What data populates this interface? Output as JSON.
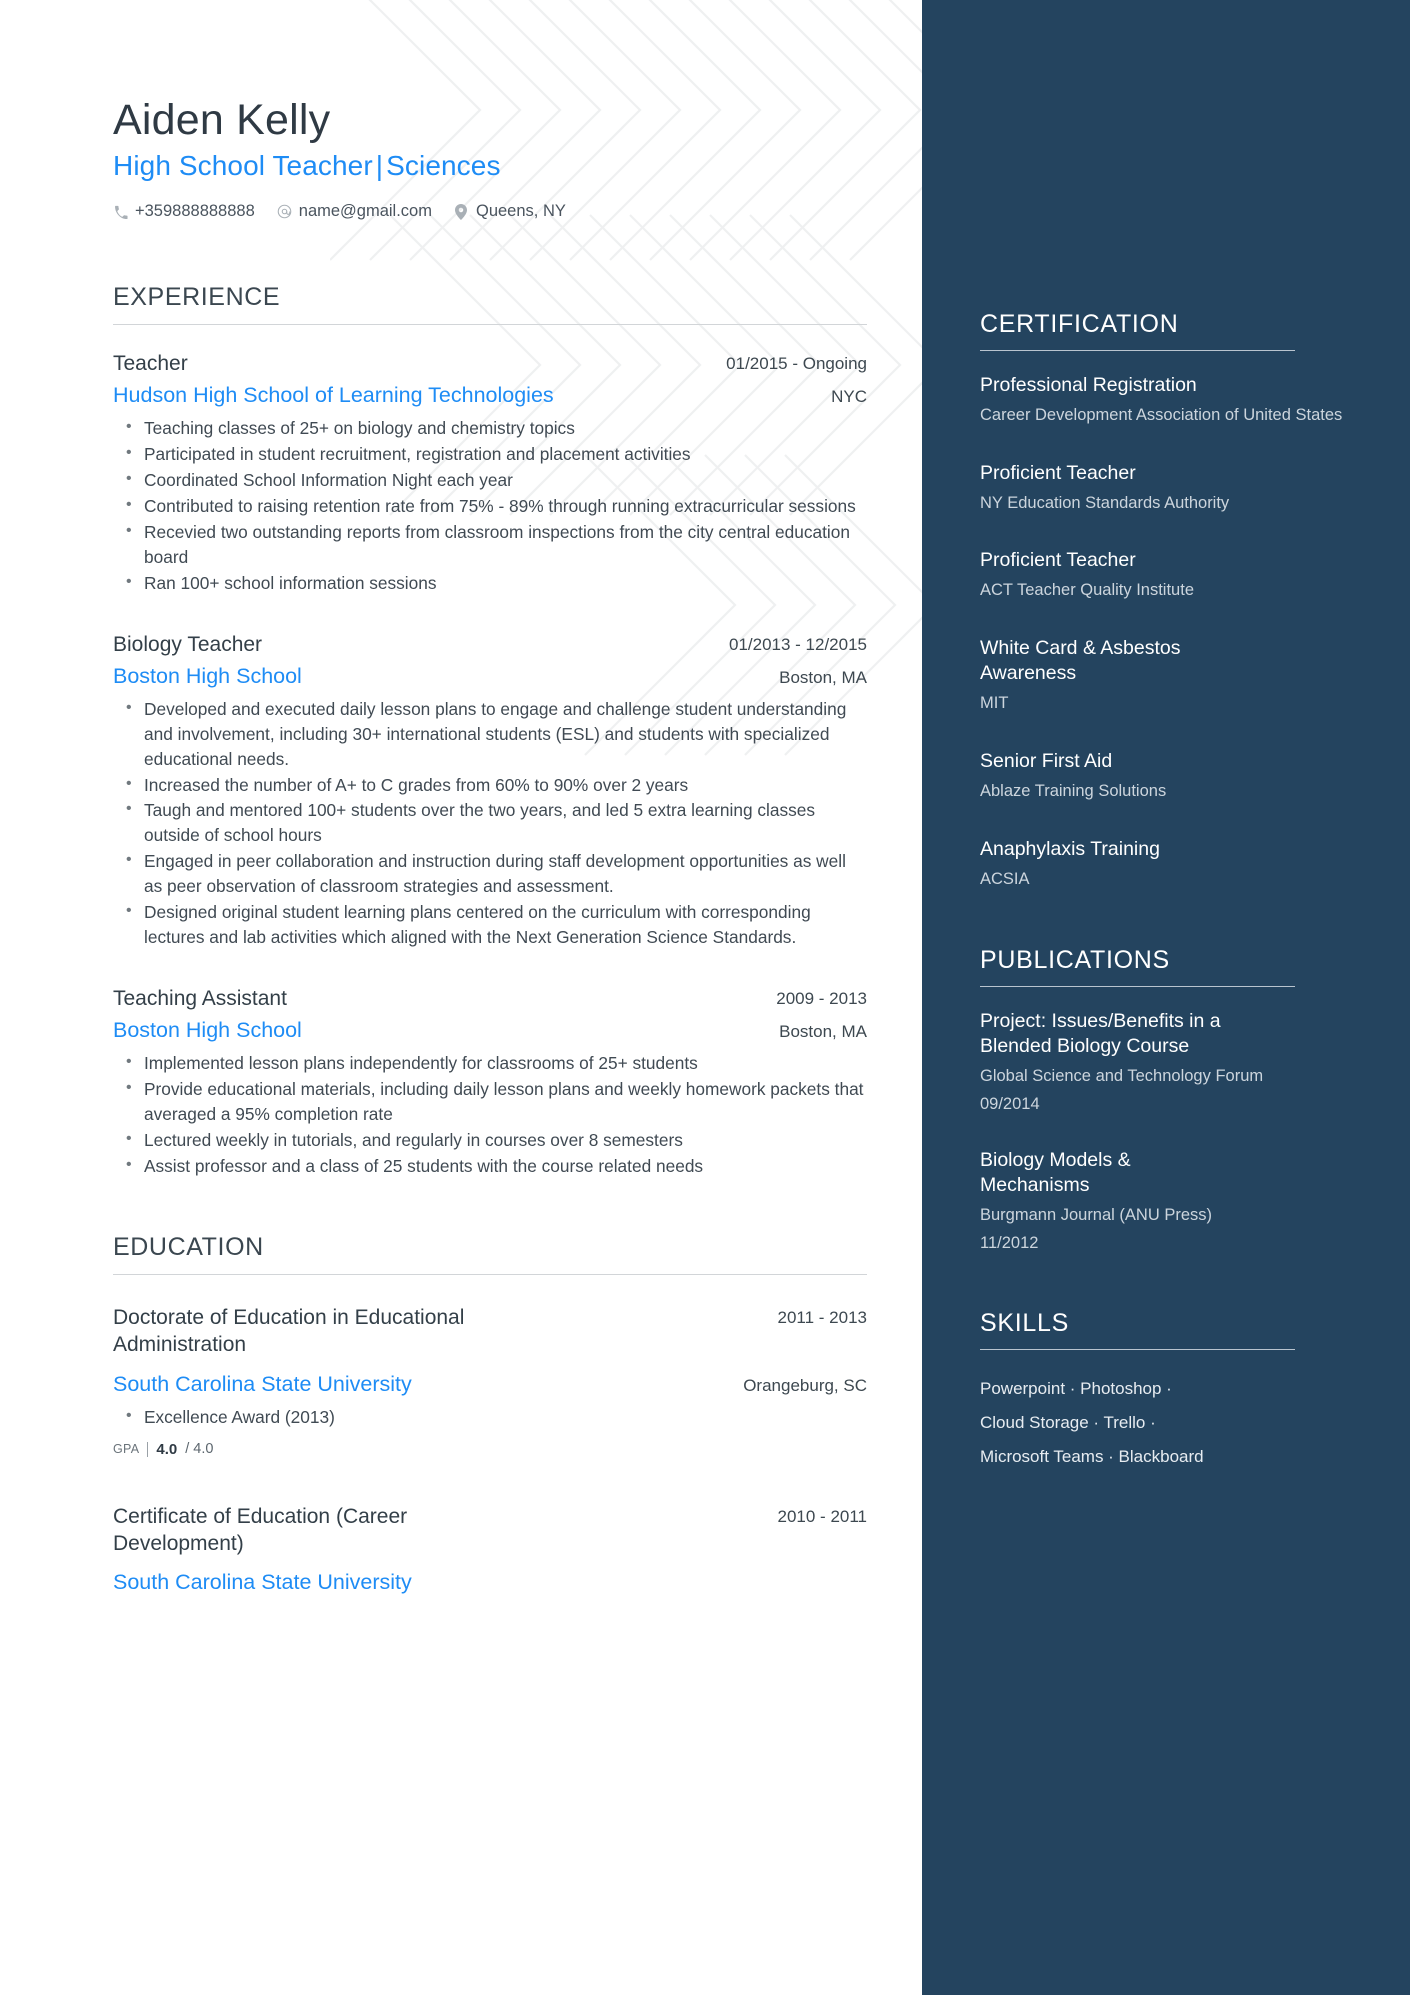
{
  "theme": {
    "accent_blue": "#1e8cf5",
    "sidebar_bg": "#24445f",
    "heading_color": "#3b4750",
    "body_color": "#404a53"
  },
  "header": {
    "name": "Aiden Kelly",
    "headline_left": "High School Teacher",
    "headline_divider": "|",
    "headline_right": "Sciences",
    "contacts": [
      {
        "icon": "phone-icon",
        "value": "+359888888888"
      },
      {
        "icon": "email-icon",
        "value": "name@gmail.com"
      },
      {
        "icon": "location-pin-icon",
        "value": "Queens, NY"
      }
    ]
  },
  "experience": {
    "title": "EXPERIENCE",
    "entries": [
      {
        "role": "Teacher",
        "date": "01/2015 - Ongoing",
        "org": "Hudson High School of Learning Technologies",
        "location": "NYC",
        "bullets": [
          "Teaching classes of 25+ on biology and chemistry topics",
          "Participated in student recruitment, registration and placement activities",
          "Coordinated School Information Night each year",
          "Contributed to raising retention rate from 75% - 89% through running extracurricular sessions",
          "Recevied two outstanding reports from classroom inspections from the city central education board",
          "Ran 100+ school information sessions"
        ]
      },
      {
        "role": "Biology Teacher",
        "date": "01/2013 - 12/2015",
        "org": "Boston High School",
        "location": "Boston, MA",
        "bullets": [
          "Developed and executed daily lesson plans to engage and challenge student understanding and involvement, including 30+ international students (ESL) and students with specialized educational needs.",
          "Increased the number of A+ to C grades from 60% to 90% over 2 years",
          "Taugh and mentored 100+ students over the two years, and led 5 extra learning classes outside of school hours",
          "Engaged in peer collaboration and instruction during staff development opportunities as well as peer observation of classroom strategies and assessment.",
          "Designed original student learning plans centered on the curriculum with corresponding lectures and lab activities which aligned with the Next Generation Science Standards."
        ]
      },
      {
        "role": "Teaching Assistant",
        "date": "2009 - 2013",
        "org": "Boston High School",
        "location": "Boston, MA",
        "bullets": [
          "Implemented lesson plans independently for classrooms of 25+ students",
          "Provide educational materials, including daily lesson plans and weekly homework packets that averaged a 95% completion rate",
          "Lectured weekly in tutorials, and regularly in courses over 8 semesters",
          "Assist professor and a class of 25 students with the course related needs"
        ]
      }
    ]
  },
  "education": {
    "title": "EDUCATION",
    "entries": [
      {
        "degree": "Doctorate of Education in Educational Administration",
        "date": "2011 - 2013",
        "school": "South Carolina State University",
        "location": "Orangeburg, SC",
        "bullets": [
          "Excellence Award (2013)"
        ],
        "gpa_label": "GPA",
        "gpa_value": "4.0",
        "gpa_max": "/ 4.0"
      },
      {
        "degree": "Certificate of Education (Career Development)",
        "date": "2010 - 2011",
        "school": "South Carolina State University",
        "location": "",
        "bullets": [],
        "gpa_label": "",
        "gpa_value": "",
        "gpa_max": ""
      }
    ]
  },
  "certification": {
    "title": "CERTIFICATION",
    "entries": [
      {
        "name": "Professional Registration",
        "issuer": "Career Development Association of United States"
      },
      {
        "name": "Proficient Teacher",
        "issuer": "NY Education Standards Authority"
      },
      {
        "name": "Proficient Teacher",
        "issuer": "ACT Teacher Quality Institute"
      },
      {
        "name": "White Card & Asbestos Awareness",
        "issuer": "MIT"
      },
      {
        "name": "Senior First Aid",
        "issuer": "Ablaze Training Solutions"
      },
      {
        "name": "Anaphylaxis Training",
        "issuer": "ACSIA"
      }
    ]
  },
  "publications": {
    "title": "PUBLICATIONS",
    "entries": [
      {
        "name": "Project: Issues/Benefits in a Blended Biology Course",
        "publisher": "Global Science and Technology Forum",
        "date": "09/2014"
      },
      {
        "name": "Biology Models & Mechanisms",
        "publisher": "Burgmann Journal (ANU Press)",
        "date": "11/2012"
      }
    ]
  },
  "skills": {
    "title": "SKILLS",
    "lines": [
      "Powerpoint · Photoshop ·",
      "Cloud Storage · Trello ·",
      "Microsoft Teams · Blackboard"
    ]
  }
}
